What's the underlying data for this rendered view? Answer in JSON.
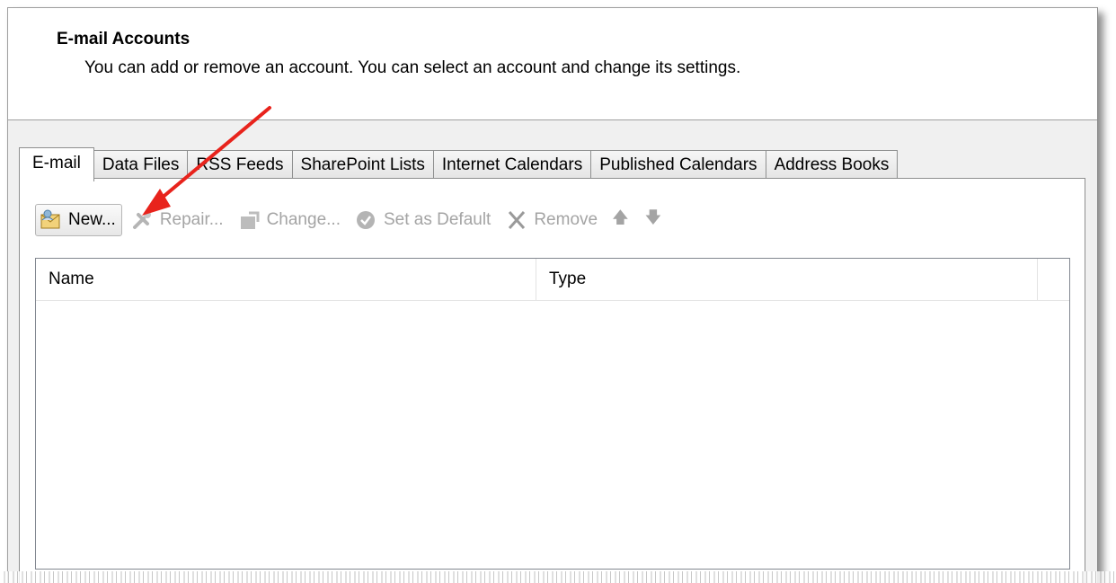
{
  "header": {
    "title": "E-mail Accounts",
    "subtitle": "You can add or remove an account. You can select an account and change its settings."
  },
  "tabs": [
    {
      "label": "E-mail",
      "active": true
    },
    {
      "label": "Data Files"
    },
    {
      "label": "RSS Feeds"
    },
    {
      "label": "SharePoint Lists"
    },
    {
      "label": "Internet Calendars"
    },
    {
      "label": "Published Calendars"
    },
    {
      "label": "Address Books"
    }
  ],
  "toolbar": {
    "new_label": "New...",
    "repair_label": "Repair...",
    "change_label": "Change...",
    "set_default_label": "Set as Default",
    "remove_label": "Remove",
    "icons": [
      "new-account-icon",
      "repair-icon",
      "change-icon",
      "checkmark-icon",
      "remove-x-icon",
      "arrow-up-icon",
      "arrow-down-icon"
    ]
  },
  "list": {
    "columns": [
      "Name",
      "Type"
    ],
    "rows": []
  },
  "colors": {
    "annotation_arrow": "#e8231c",
    "disabled_text": "#a4a4a4"
  }
}
